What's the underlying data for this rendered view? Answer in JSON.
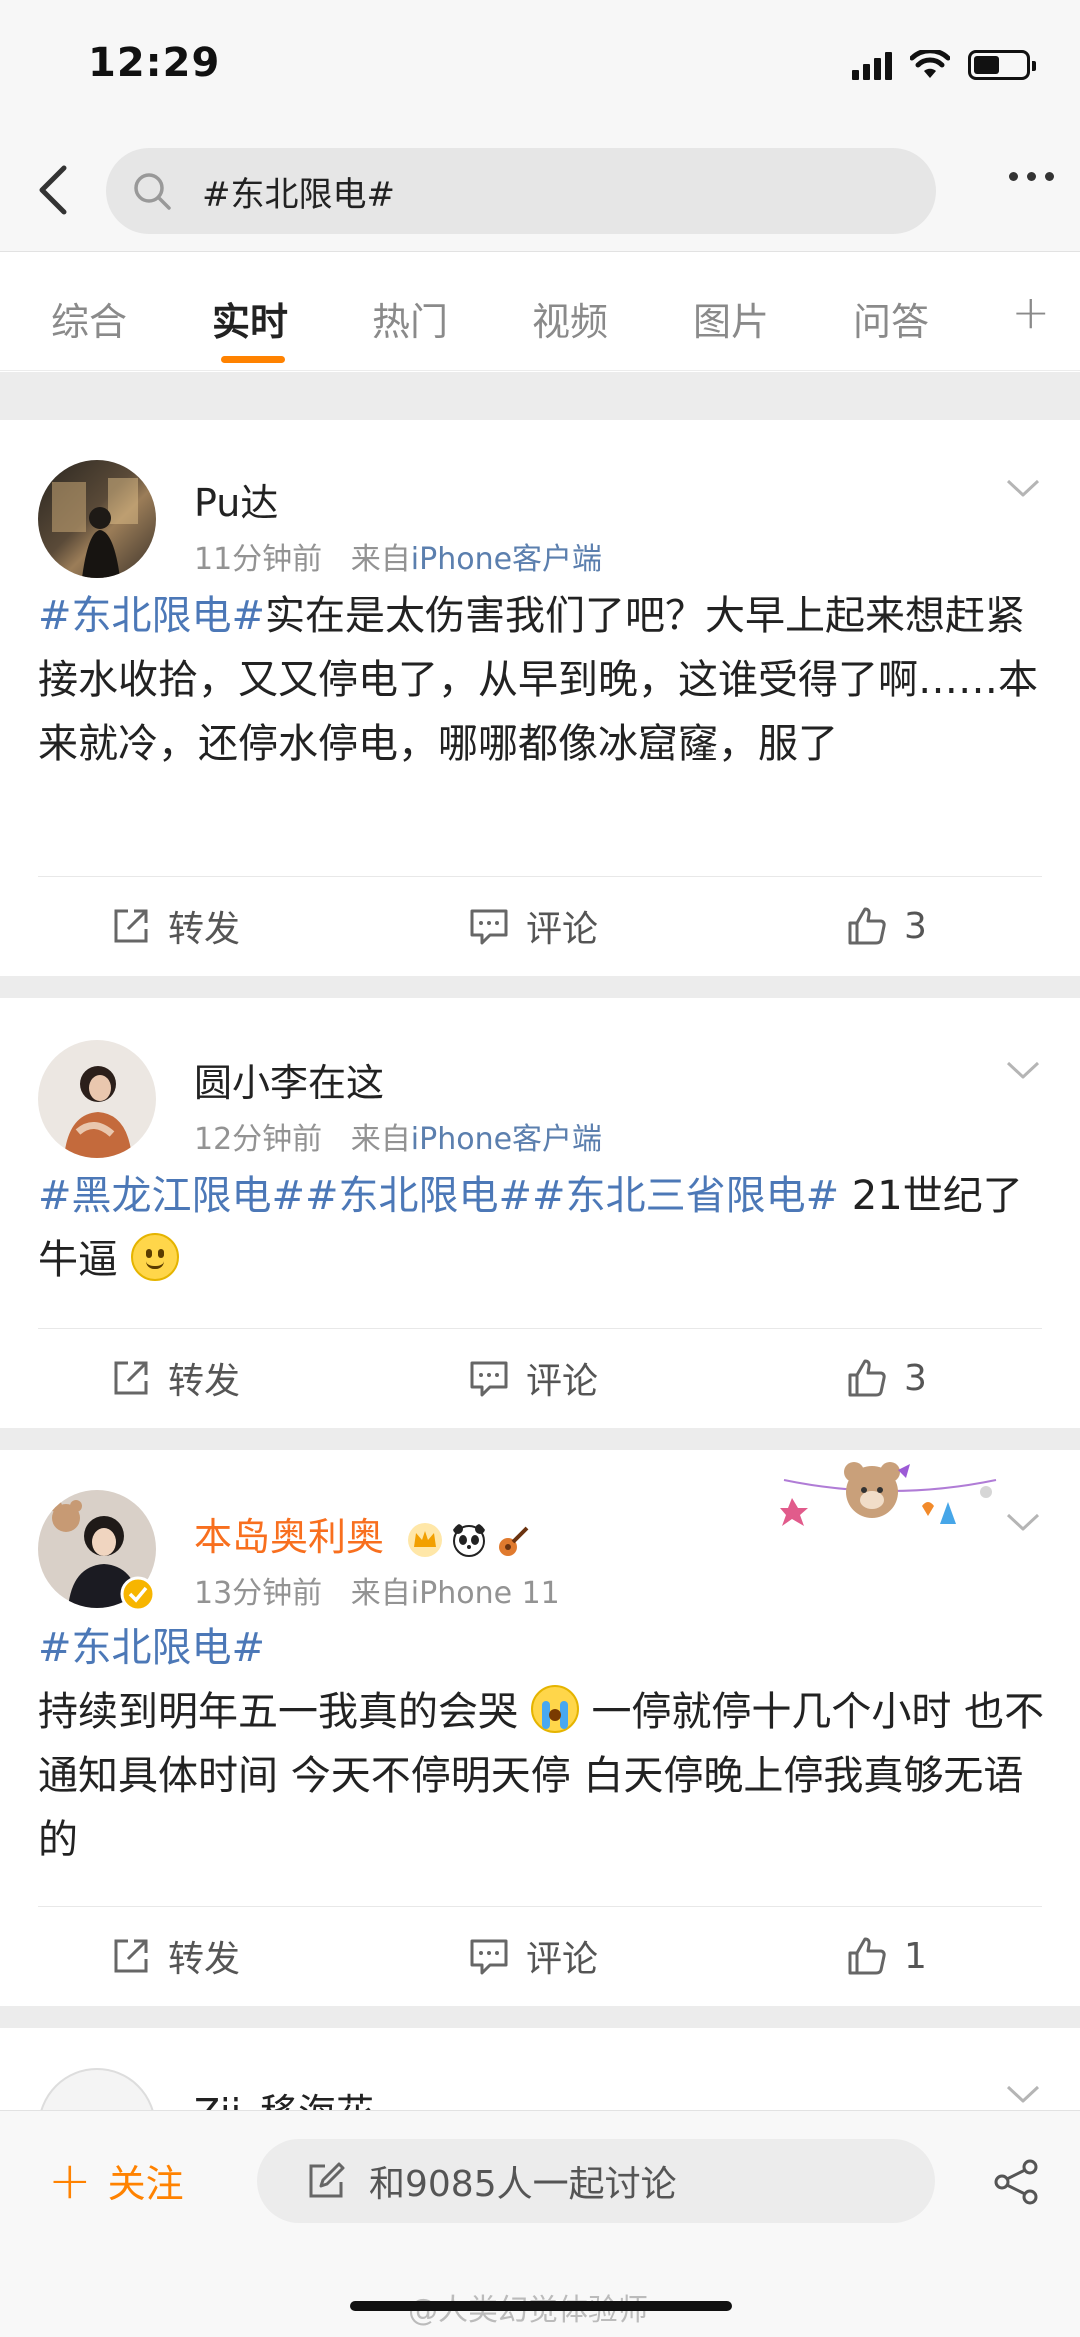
{
  "status": {
    "time": "12:29"
  },
  "search": {
    "query": "#东北限电#"
  },
  "tabs": [
    {
      "label": "综合"
    },
    {
      "label": "实时"
    },
    {
      "label": "热门"
    },
    {
      "label": "视频"
    },
    {
      "label": "图片"
    },
    {
      "label": "问答"
    }
  ],
  "actions_labels": {
    "repost": "转发",
    "comment": "评论"
  },
  "posts": [
    {
      "username": "Pu达",
      "time": "11分钟前",
      "from_prefix": "来自",
      "source": "iPhone客户端",
      "tag": "#东北限电#",
      "text": "实在是太伤害我们了吧？大早上起来想赶紧接水收拾，又又停电了，从早到晚，这谁受得了啊……本来就冷，还停水停电，哪哪都像冰窟窿，服了",
      "likes": "3"
    },
    {
      "username": "圆小李在这",
      "time": "12分钟前",
      "from_prefix": "来自",
      "source": "iPhone客户端",
      "tag": "#黑龙江限电##东北限电##东北三省限电#",
      "text": " 21世纪了 牛逼",
      "likes": "3"
    },
    {
      "username": "本岛奥利奥",
      "time": "13分钟前",
      "from_prefix": "来自",
      "source": "iPhone 11",
      "tag": "#东北限电#",
      "text_1": "持续到明年五一我真的会哭",
      "text_2": "一停就停十几个小时 也不通知具体时间 今天不停明天停 白天停晚上停我真够无语的",
      "likes": "1"
    },
    {
      "username": "Zii_移海花"
    }
  ],
  "bottom": {
    "follow": "关注",
    "discuss": "和9085人一起讨论",
    "watermark": "@人类幻觉体验师"
  },
  "colors": {
    "accent": "#ff8200",
    "link": "#4c78b7",
    "vip_name": "#f86f1e"
  }
}
